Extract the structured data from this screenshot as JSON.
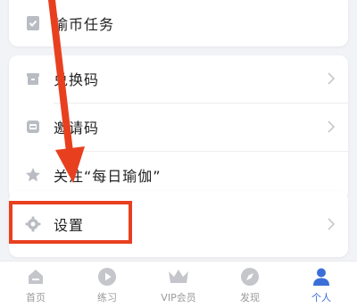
{
  "menu": {
    "coin_tasks": {
      "label": "瑜币任务",
      "icon": "checkmark-badge-icon"
    },
    "redeem_code": {
      "label": "兑换码",
      "icon": "gift-box-icon"
    },
    "invite_code": {
      "label": "邀请码",
      "icon": "envelope-icon"
    },
    "follow": {
      "label": "关注“每日瑜伽”",
      "icon": "star-icon"
    },
    "settings": {
      "label": "设置",
      "icon": "gear-icon"
    }
  },
  "tabbar": {
    "items": [
      {
        "label": "首页",
        "icon": "home-icon",
        "active": false
      },
      {
        "label": "练习",
        "icon": "play-icon",
        "active": false
      },
      {
        "label": "VIP会员",
        "icon": "crown-icon",
        "active": false
      },
      {
        "label": "发现",
        "icon": "compass-icon",
        "active": false
      },
      {
        "label": "个人",
        "icon": "person-icon",
        "active": true
      }
    ]
  },
  "colors": {
    "annotation_red": "#e8401f",
    "active_tab": "#3b6fd8",
    "inactive_tab": "#9a9a9a"
  }
}
